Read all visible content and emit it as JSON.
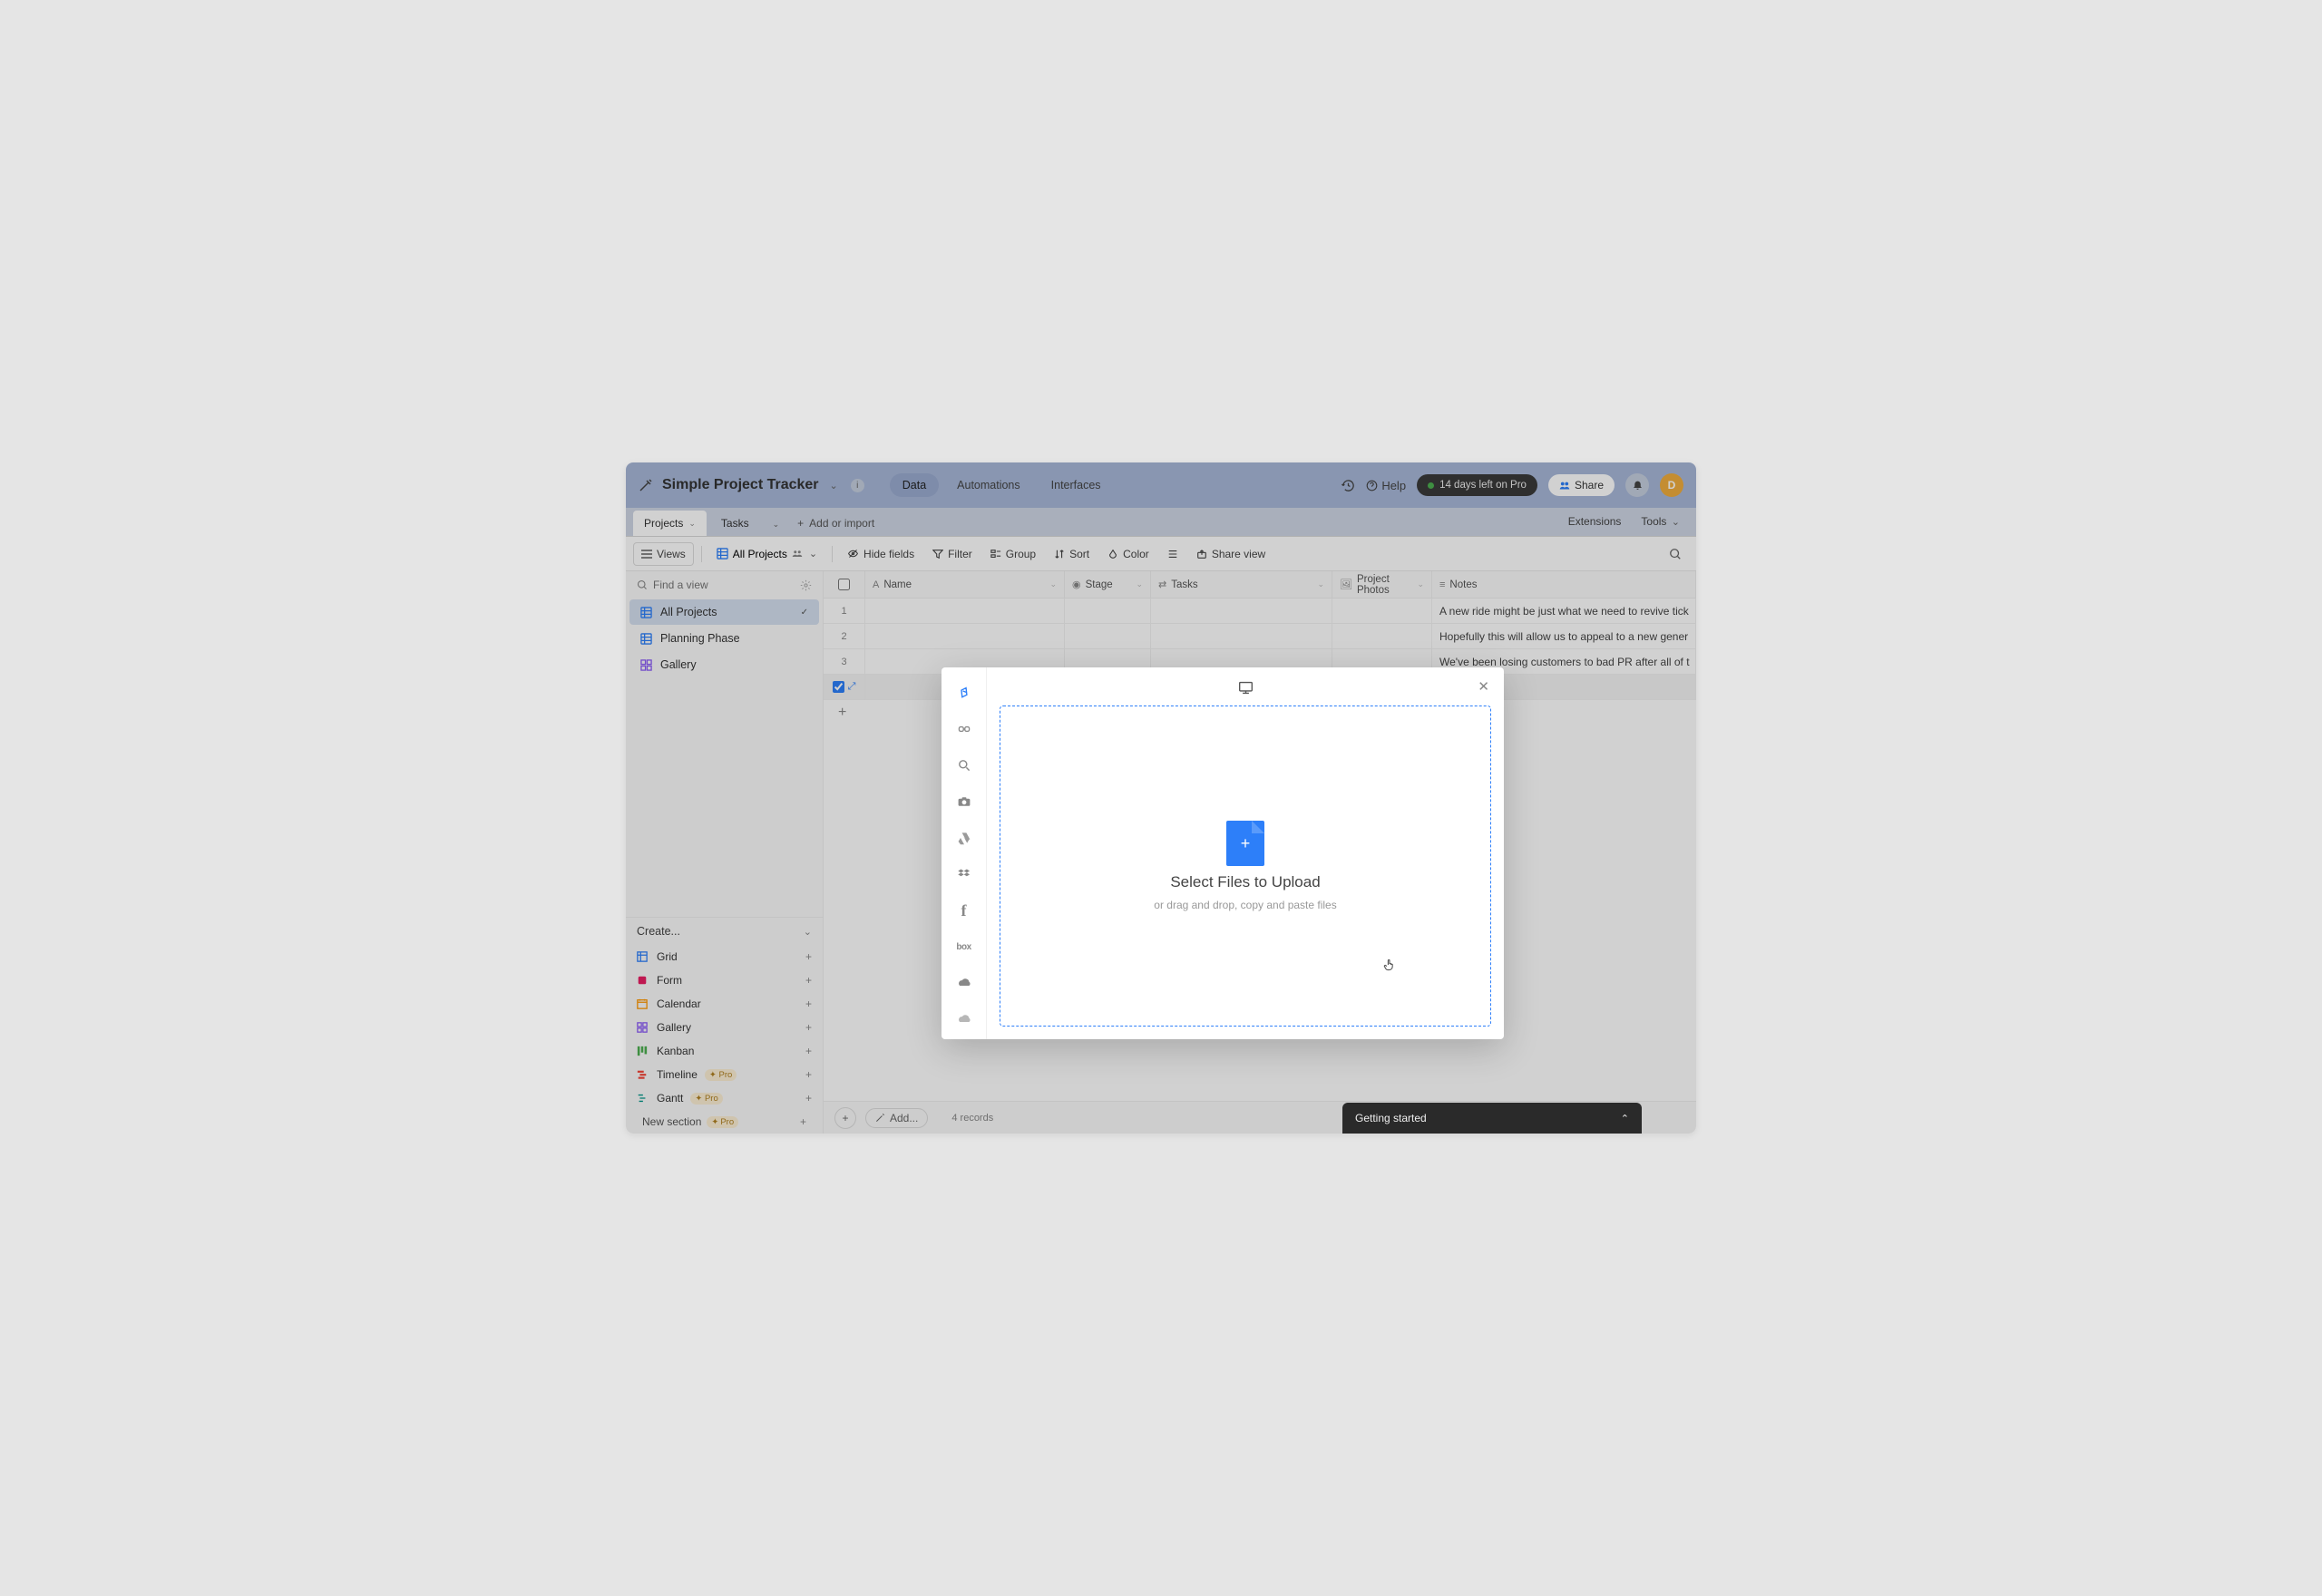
{
  "header": {
    "base_title": "Simple Project Tracker",
    "tabs": {
      "data": "Data",
      "automations": "Automations",
      "interfaces": "Interfaces"
    },
    "help": "Help",
    "trial": "14 days left on Pro",
    "share": "Share",
    "avatar_initial": "D"
  },
  "table_tabs": {
    "active": "Projects",
    "second": "Tasks",
    "add_import": "Add or import",
    "extensions": "Extensions",
    "tools": "Tools"
  },
  "toolbar": {
    "views": "Views",
    "all_projects": "All Projects",
    "hide_fields": "Hide fields",
    "filter": "Filter",
    "group": "Group",
    "sort": "Sort",
    "color": "Color",
    "share_view": "Share view"
  },
  "sidebar": {
    "find_placeholder": "Find a view",
    "views": [
      {
        "label": "All Projects",
        "active": true,
        "icon": "grid",
        "color": "vi-blue"
      },
      {
        "label": "Planning Phase",
        "active": false,
        "icon": "grid",
        "color": "vi-blue"
      },
      {
        "label": "Gallery",
        "active": false,
        "icon": "gallery",
        "color": "vi-purple"
      }
    ],
    "create_header": "Create...",
    "create_items": [
      {
        "label": "Grid",
        "icon_class": "ic-grid",
        "pro": false
      },
      {
        "label": "Form",
        "icon_class": "ic-form",
        "pro": false
      },
      {
        "label": "Calendar",
        "icon_class": "ic-cal",
        "pro": false
      },
      {
        "label": "Gallery",
        "icon_class": "ic-gal",
        "pro": false
      },
      {
        "label": "Kanban",
        "icon_class": "ic-kan",
        "pro": false
      },
      {
        "label": "Timeline",
        "icon_class": "ic-tl",
        "pro": true
      },
      {
        "label": "Gantt",
        "icon_class": "ic-gantt",
        "pro": true
      }
    ],
    "pro_label": "Pro",
    "new_section": "New section"
  },
  "grid": {
    "columns": {
      "name": "Name",
      "stage": "Stage",
      "tasks": "Tasks",
      "photos": "Project Photos",
      "notes": "Notes"
    },
    "rows": [
      {
        "num": "1",
        "notes": "A new ride might be just what we need to revive tick"
      },
      {
        "num": "2",
        "notes": "Hopefully this will allow us to appeal to a new gener"
      },
      {
        "num": "3",
        "notes": "We've been losing customers to bad PR after all of t"
      }
    ],
    "add_label": "Add...",
    "records": "4 records"
  },
  "modal": {
    "title": "Select Files to Upload",
    "subtitle": "or drag and drop, copy and paste files",
    "sources": [
      "device",
      "link",
      "search",
      "camera",
      "gdrive",
      "dropbox",
      "facebook",
      "box",
      "onedrive",
      "cloud2"
    ]
  },
  "getting_started": "Getting started"
}
